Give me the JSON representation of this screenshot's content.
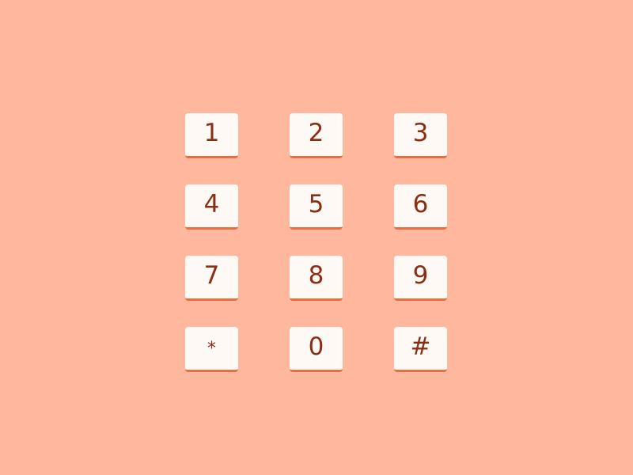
{
  "colors": {
    "background": "#FFB79E",
    "key_face": "#FFF9F6",
    "key_shadow": "#EE6B3D",
    "key_text": "#8A2E14"
  },
  "keypad": {
    "keys": [
      {
        "label": "1"
      },
      {
        "label": "2"
      },
      {
        "label": "3"
      },
      {
        "label": "4"
      },
      {
        "label": "5"
      },
      {
        "label": "6"
      },
      {
        "label": "7"
      },
      {
        "label": "8"
      },
      {
        "label": "9"
      },
      {
        "label": "*"
      },
      {
        "label": "0"
      },
      {
        "label": "#"
      }
    ]
  }
}
